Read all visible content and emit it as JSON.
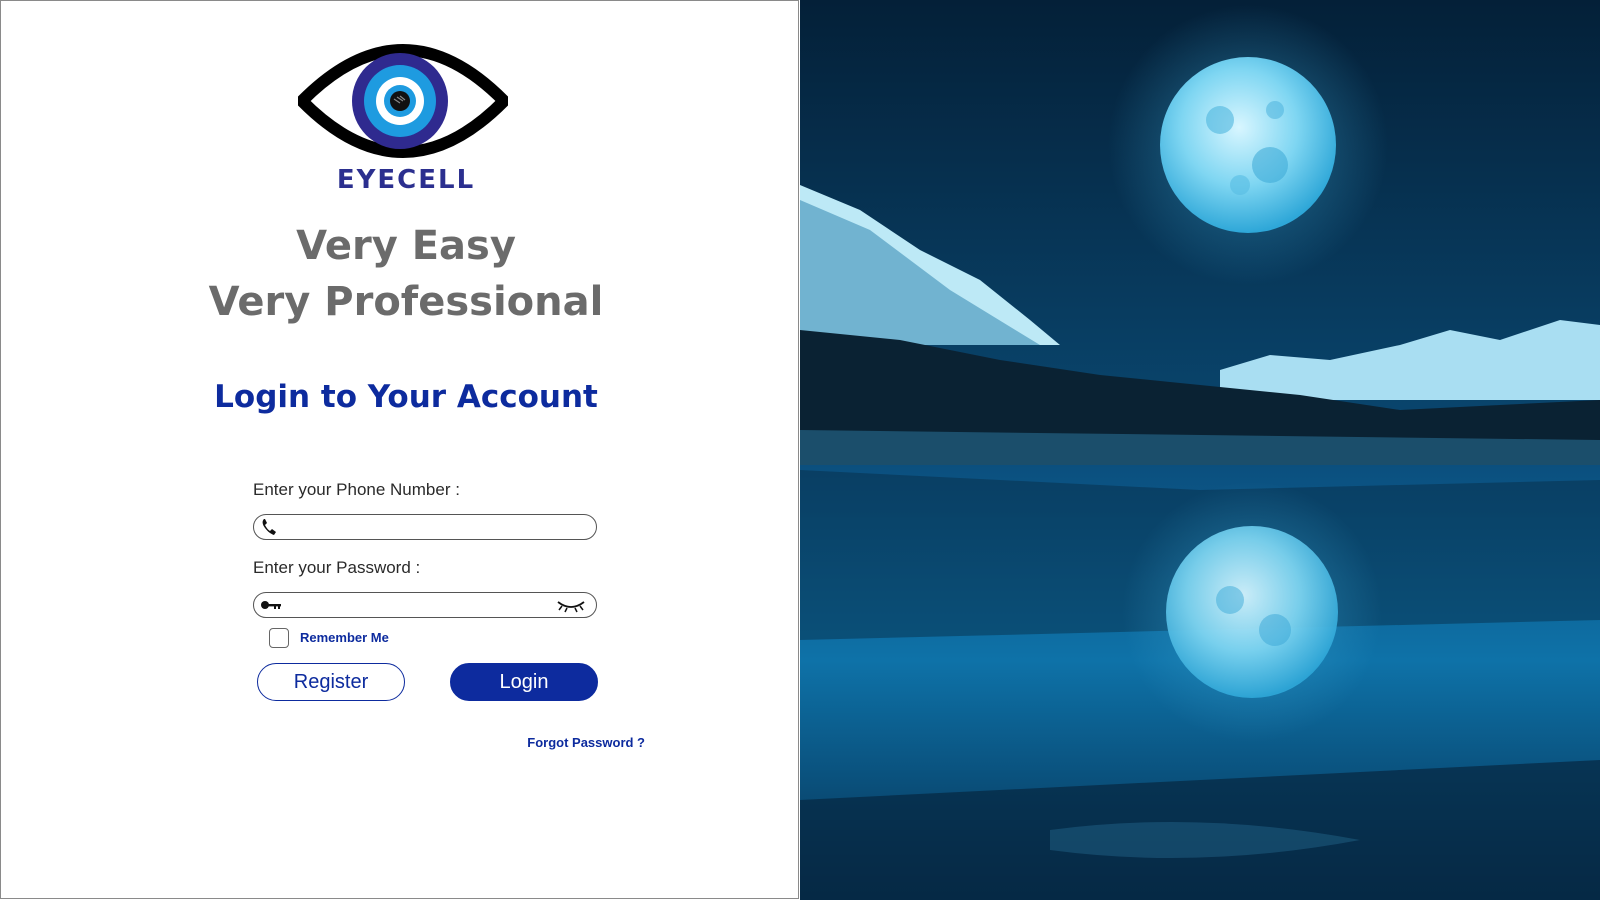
{
  "brand": {
    "name": "EYECELL",
    "logo_icon": "eye-logo-icon"
  },
  "tagline": {
    "line1": "Very Easy",
    "line2": "Very Professional"
  },
  "login": {
    "heading": "Login to Your Account",
    "phone_label": "Enter your Phone Number :",
    "phone_value": "",
    "phone_icon": "phone-icon",
    "password_label": "Enter your Password  :",
    "password_value": "",
    "password_icon": "key-icon",
    "password_toggle_icon": "eye-closed-icon",
    "remember_me": {
      "label": "Remember Me",
      "checked": false
    },
    "register_label": "Register",
    "login_label": "Login",
    "forgot_password": "Forgot Password ?"
  },
  "colors": {
    "accent": "#0d2b9e",
    "tagline": "#6b6b6b",
    "background_night": "#0a4d7c"
  },
  "hero_image": {
    "subject": "night lake with full moon reflection",
    "icon": "landscape-image"
  }
}
